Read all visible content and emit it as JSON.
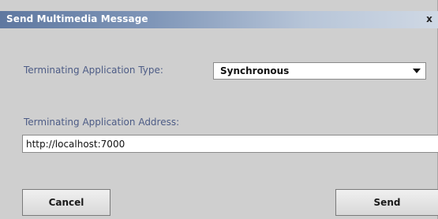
{
  "window": {
    "title": "Send Multimedia Message",
    "close_label": "x"
  },
  "form": {
    "type_label": "Terminating Application Type:",
    "type_selected": "Synchronous",
    "address_label": "Terminating Application Address:",
    "address_value": "http://localhost:7000"
  },
  "buttons": {
    "cancel_label": "Cancel",
    "send_label": "Send"
  },
  "colors": {
    "title_bar_start": "#5f78a0",
    "label_text": "#4d5c86",
    "dialog_bg": "#cfcfcf"
  }
}
